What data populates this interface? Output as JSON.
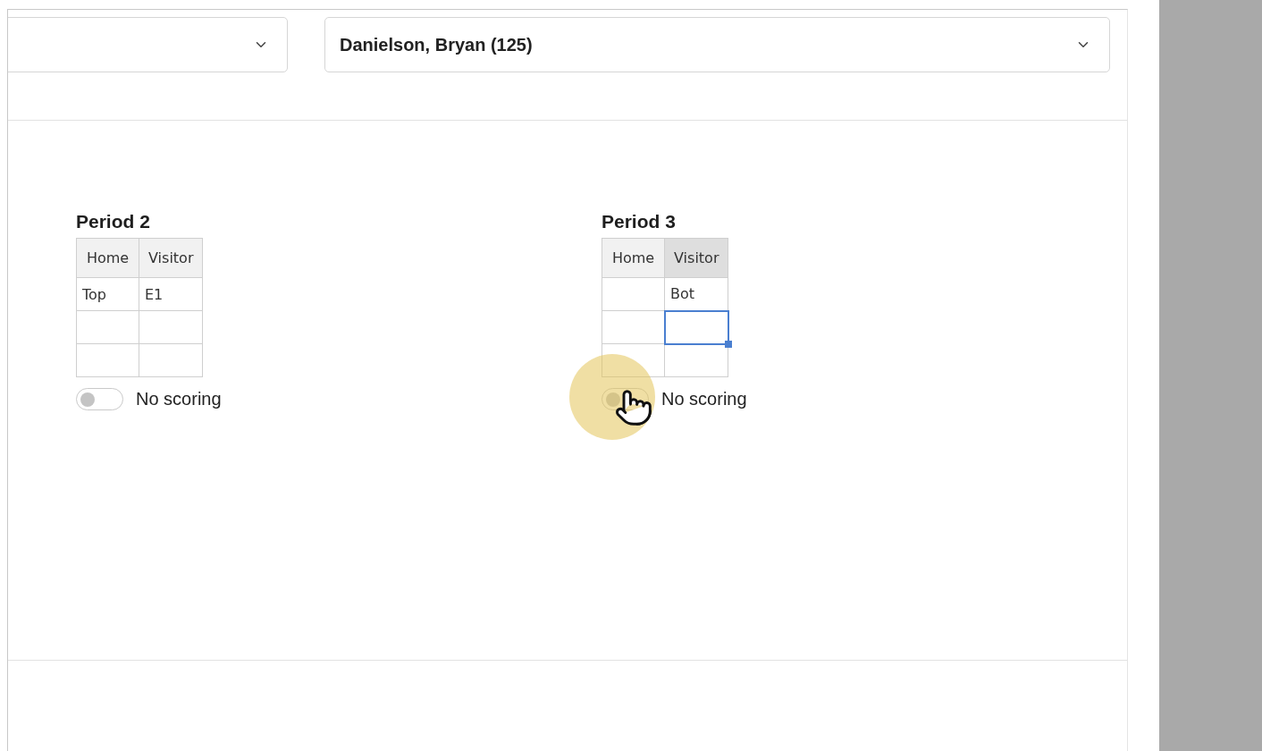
{
  "selects": [
    {
      "kind": "blank"
    },
    {
      "kind": "value",
      "value": "Danielson, Bryan (125)"
    }
  ],
  "periods": [
    {
      "title": "Period 2",
      "columns": [
        {
          "label": "Home",
          "selected": false
        },
        {
          "label": "Visitor",
          "selected": false
        }
      ],
      "rows": [
        [
          {
            "text": "Top",
            "selected": false
          },
          {
            "text": "E1",
            "selected": false
          }
        ],
        [
          {
            "selected": false
          },
          {
            "selected": false
          }
        ],
        [
          {
            "selected": false
          },
          {
            "selected": false
          }
        ]
      ],
      "no_scoring": {
        "label": "No scoring",
        "on": false
      },
      "pointer": false
    },
    {
      "title": "Period 3",
      "columns": [
        {
          "label": "Home",
          "selected": false
        },
        {
          "label": "Visitor",
          "selected": true
        }
      ],
      "rows": [
        [
          {
            "selected": false
          },
          {
            "text": "Bot",
            "selected": false
          }
        ],
        [
          {
            "selected": false
          },
          {
            "selected": true
          }
        ],
        [
          {
            "selected": false
          },
          {
            "selected": false
          }
        ]
      ],
      "no_scoring": {
        "label": "No scoring",
        "on": false
      },
      "pointer": true
    }
  ]
}
